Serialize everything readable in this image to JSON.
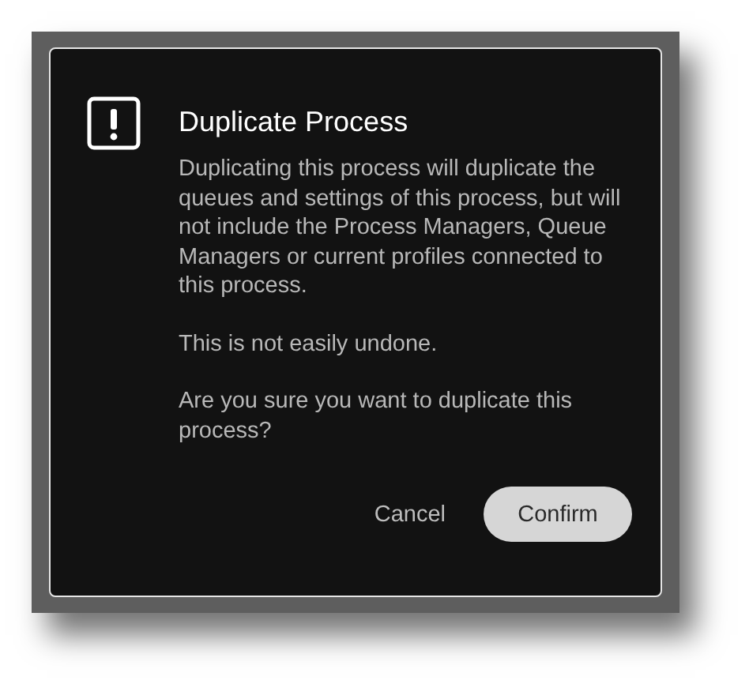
{
  "dialog": {
    "title": "Duplicate Process",
    "paragraphs": [
      "Duplicating this process will duplicate the queues and settings of this process, but will not include the Process Managers, Queue Managers or current profiles connected to this process.",
      "This is not easily undone.",
      "Are you sure you want to duplicate this process?"
    ],
    "buttons": [
      {
        "label": "Cancel",
        "kind": "text"
      },
      {
        "label": "Confirm",
        "kind": "pill"
      }
    ]
  }
}
